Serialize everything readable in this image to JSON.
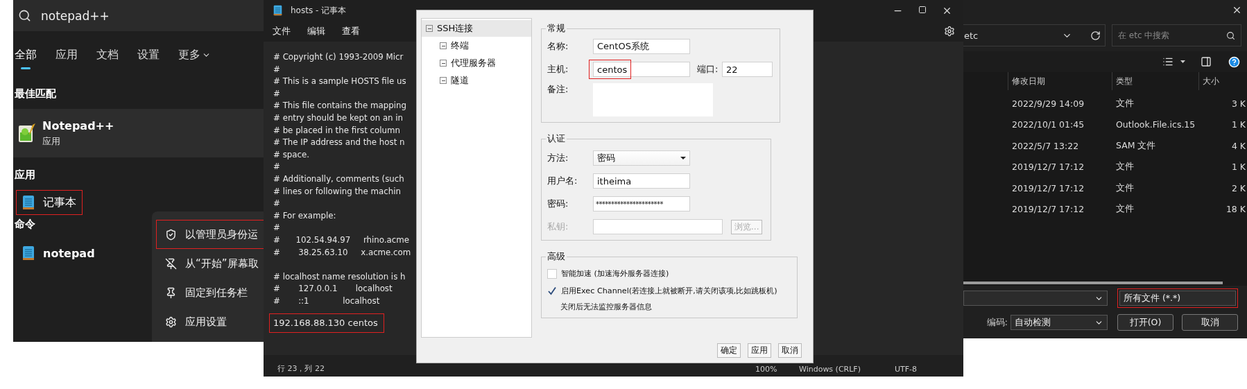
{
  "search_panel": {
    "query": "notepad++",
    "tabs": [
      {
        "label": "全部",
        "selected": true
      },
      {
        "label": "应用",
        "selected": false
      },
      {
        "label": "文档",
        "selected": false
      },
      {
        "label": "设置",
        "selected": false
      },
      {
        "label": "更多",
        "selected": false,
        "kind": "menu"
      }
    ],
    "best_match": {
      "heading": "最佳匹配",
      "name": "Notepad++",
      "type": "应用"
    },
    "sections": [
      {
        "heading": "应用",
        "items": [
          {
            "label": "记事本",
            "highlighted": true
          }
        ]
      },
      {
        "heading": "命令",
        "items": [
          {
            "label": "notepad",
            "highlighted": false
          }
        ]
      }
    ],
    "context_menu": [
      {
        "label": "以管理员身份运",
        "highlighted": true
      },
      {
        "label": "从“开始”屏幕取",
        "highlighted": false
      },
      {
        "label": "固定到任务栏",
        "highlighted": false
      },
      {
        "label": "应用设置",
        "highlighted": false
      }
    ]
  },
  "notepad": {
    "title": "hosts - 记事本",
    "menu": [
      "文件",
      "编辑",
      "查看"
    ],
    "blocks": [
      [
        "# Copyright (c) 1993-2009 Micr",
        "#",
        "# This is a sample HOSTS file us",
        "#",
        "# This file contains the mapping",
        "# entry should be kept on an in",
        "# be placed in the first column",
        "# The IP address and the host n",
        "# space.",
        "#",
        "# Additionally, comments (such",
        "# lines or following the machin",
        "#",
        "# For example:",
        "#",
        "#      102.54.94.97     rhino.acme",
        "#       38.25.63.10     x.acme.com"
      ],
      [
        "# localhost name resolution is h",
        "#       127.0.0.1       localhost",
        "#       ::1             localhost"
      ]
    ],
    "last_line": {
      "text": "192.168.88.130 centos",
      "highlighted": true
    },
    "status": {
      "position": "行 23，列 22",
      "zoom": "100%",
      "line_ending": "Windows (CRLF)",
      "encoding": "UTF-8"
    }
  },
  "ssh_dialog": {
    "tree": [
      {
        "label": "SSH连接",
        "selected": true,
        "expanded": true,
        "children": [
          {
            "label": "终端",
            "selected": false,
            "expanded": true
          },
          {
            "label": "代理服务器",
            "selected": false,
            "expanded": true
          },
          {
            "label": "隧道",
            "selected": false,
            "expanded": true
          }
        ]
      }
    ],
    "general": {
      "legend": "常规",
      "name": {
        "label": "名称:",
        "value": "CentOS系统"
      },
      "host": {
        "label": "主机:",
        "value": "centos",
        "highlighted": true
      },
      "port": {
        "label": "端口:",
        "value": "22"
      },
      "note": {
        "label": "备注:"
      }
    },
    "auth": {
      "legend": "认证",
      "method": {
        "label": "方法:",
        "value": "密码"
      },
      "username": {
        "label": "用户名:",
        "value": "itheima"
      },
      "password": {
        "label": "密码:",
        "value": "**********************"
      },
      "private_key": {
        "label": "私钥:",
        "disabled": true,
        "browse": "浏览..."
      }
    },
    "advanced": {
      "legend": "高级",
      "options": [
        {
          "label": "智能加速 (加速海外服务器连接)",
          "checked": false
        },
        {
          "label": "启用Exec Channel(若连接上就被断开,请关闭该项,比如跳板机)",
          "checked": true,
          "note": "关闭后无法监控服务器信息"
        }
      ]
    },
    "buttons": [
      "确定",
      "应用",
      "取消"
    ]
  },
  "file_dialog": {
    "path": "etc",
    "search_placeholder": "在 etc 中搜索",
    "columns": [
      "修改日期",
      "类型",
      "大小"
    ],
    "rows": [
      {
        "modified": "2022/9/29 14:09",
        "type": "文件",
        "size": "3 K"
      },
      {
        "modified": "2022/10/1 01:45",
        "type": "Outlook.File.ics.15",
        "size": "1 K"
      },
      {
        "modified": "2022/5/7 13:22",
        "type": "SAM 文件",
        "size": "4 K"
      },
      {
        "modified": "2019/12/7 17:12",
        "type": "文件",
        "size": "1 K"
      },
      {
        "modified": "2019/12/7 17:12",
        "type": "文件",
        "size": "2 K"
      },
      {
        "modified": "2019/12/7 17:12",
        "type": "文件",
        "size": "18 K"
      }
    ],
    "file_type": {
      "value": "所有文件 (*.*)",
      "highlighted": true
    },
    "encoding": {
      "label": "编码:",
      "value": "自动检测"
    },
    "buttons": [
      "打开(O)",
      "取消"
    ]
  }
}
